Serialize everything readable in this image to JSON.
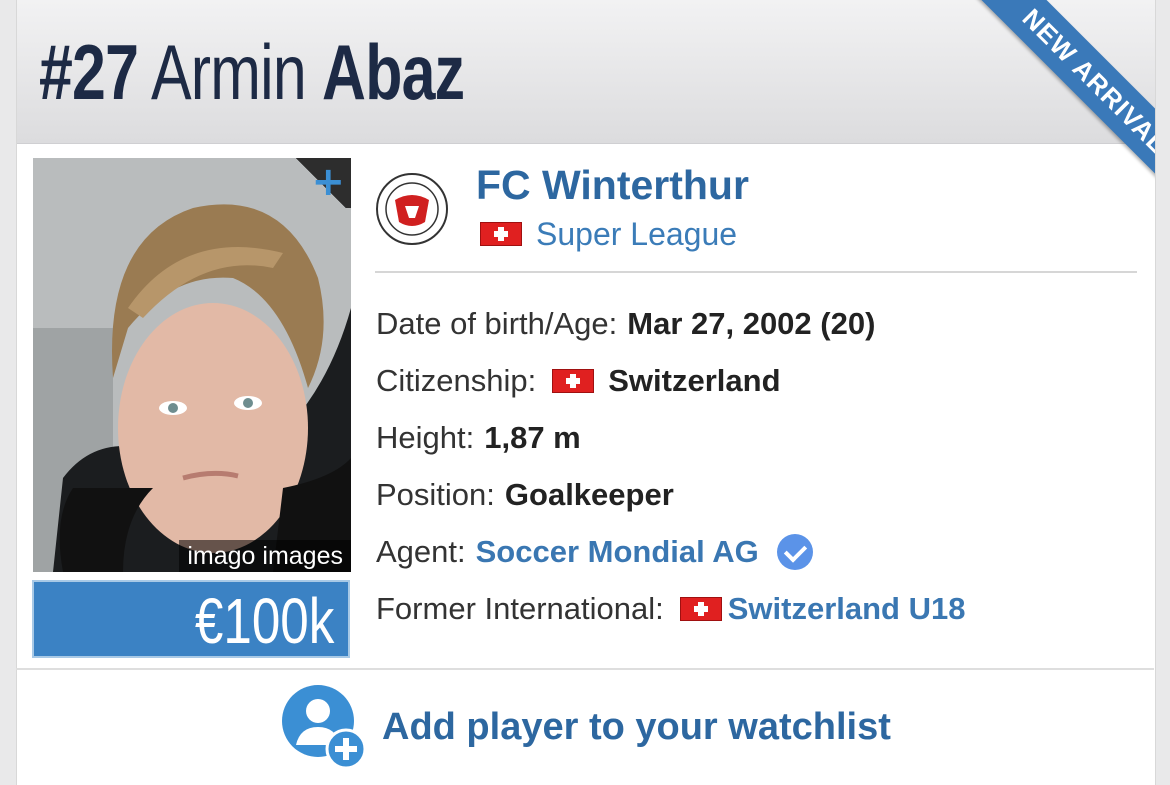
{
  "header": {
    "shirt_number": "#27",
    "first_name": "Armin",
    "last_name": "Abaz",
    "ribbon": "NEW ARRIVAL"
  },
  "photo": {
    "credit": "imago images",
    "plus_icon": "+"
  },
  "market_value": "€100k",
  "club": {
    "name": "FC Winterthur",
    "league": "Super League",
    "league_flag": "switzerland-flag"
  },
  "details": {
    "dob_label": "Date of birth/Age:",
    "dob_value": "Mar 27, 2002 (20)",
    "citizenship_label": "Citizenship:",
    "citizenship_value": "Switzerland",
    "height_label": "Height:",
    "height_value": "1,87 m",
    "position_label": "Position:",
    "position_value": "Goalkeeper",
    "agent_label": "Agent:",
    "agent_value": "Soccer Mondial AG",
    "former_international_label": "Former International:",
    "former_international_value": "Switzerland U18"
  },
  "watchlist": {
    "label": "Add player to your watchlist"
  },
  "colors": {
    "accent": "#2d67a0",
    "ribbon": "#3a79b9",
    "value_box": "#3b82c4",
    "verified": "#5b93e8"
  }
}
